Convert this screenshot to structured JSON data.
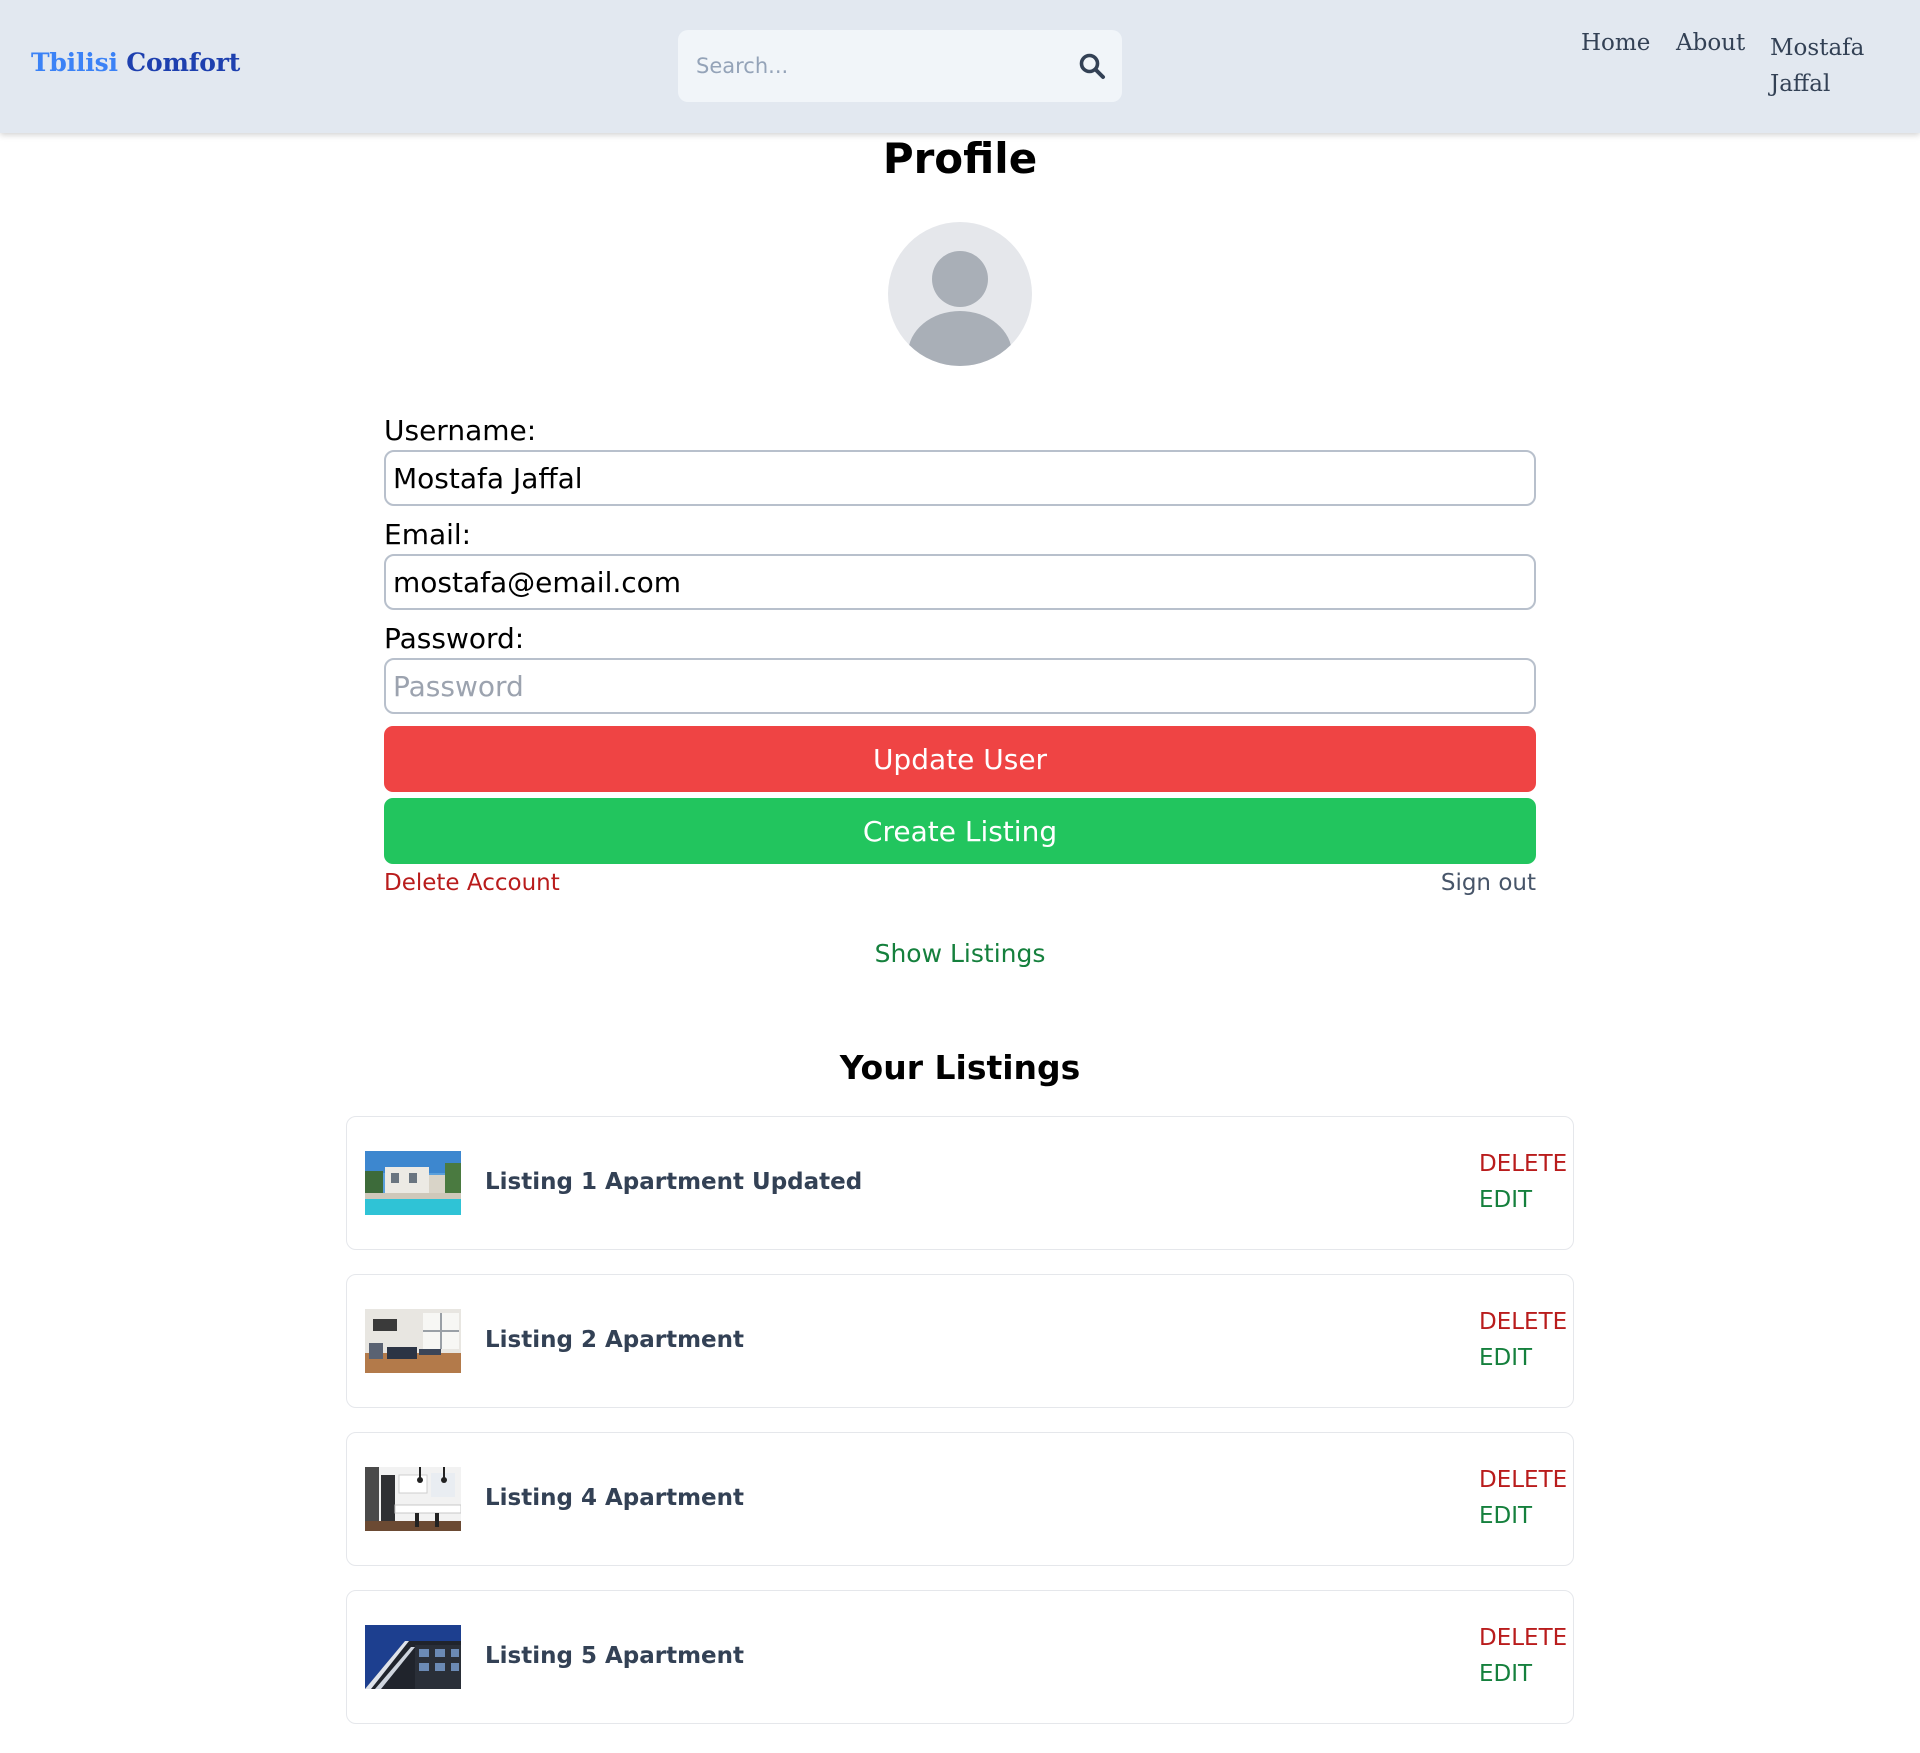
{
  "header": {
    "brand_part1": "Tbilisi",
    "brand_part2": "Comfort",
    "search_placeholder": "Search...",
    "search_icon": "search-icon",
    "nav": {
      "home": "Home",
      "about": "About",
      "user": "Mostafa Jaffal"
    }
  },
  "profile": {
    "title": "Profile",
    "avatar_icon": "user-avatar-icon",
    "username_label": "Username:",
    "username_value": "Mostafa Jaffal",
    "email_label": "Email:",
    "email_value": "mostafa@email.com",
    "password_label": "Password:",
    "password_placeholder": "Password",
    "update_button": "Update User",
    "create_button": "Create Listing",
    "delete_account": "Delete Account",
    "sign_out": "Sign out",
    "show_listings": "Show Listings"
  },
  "listings": {
    "title": "Your Listings",
    "items": [
      {
        "name": "Listing 1 Apartment Updated",
        "delete": "DELETE",
        "edit": "EDIT",
        "thumb": "pool-villa-photo"
      },
      {
        "name": "Listing 2 Apartment",
        "delete": "DELETE",
        "edit": "EDIT",
        "thumb": "living-room-photo"
      },
      {
        "name": "Listing 4 Apartment",
        "delete": "DELETE",
        "edit": "EDIT",
        "thumb": "kitchen-photo"
      },
      {
        "name": "Listing 5 Apartment",
        "delete": "DELETE",
        "edit": "EDIT",
        "thumb": "building-facade-photo"
      }
    ]
  },
  "colors": {
    "header_bg": "#e2e8f0",
    "brand_light": "#3b82f6",
    "brand_dark": "#1e40af",
    "update_button": "#ef4444",
    "create_button": "#22c55e",
    "delete_text": "#b91c1c",
    "edit_text": "#15803d"
  }
}
